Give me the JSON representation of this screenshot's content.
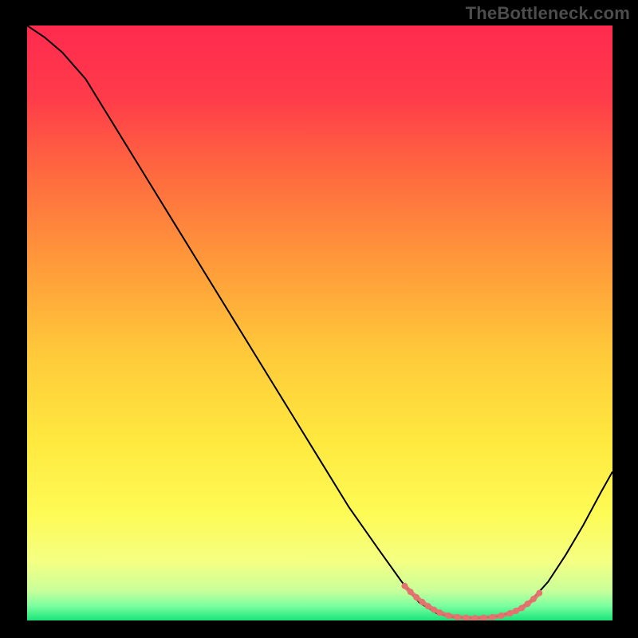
{
  "watermark": "TheBottleneck.com",
  "chart_data": {
    "type": "line",
    "title": "",
    "xlabel": "",
    "ylabel": "",
    "xlim": [
      0,
      100
    ],
    "ylim": [
      0,
      100
    ],
    "gradient_stops": [
      {
        "offset": 0.0,
        "color": "#ff2a4f"
      },
      {
        "offset": 0.12,
        "color": "#ff3b4a"
      },
      {
        "offset": 0.25,
        "color": "#ff6a3f"
      },
      {
        "offset": 0.4,
        "color": "#ff9a3a"
      },
      {
        "offset": 0.55,
        "color": "#ffc93a"
      },
      {
        "offset": 0.7,
        "color": "#ffe93f"
      },
      {
        "offset": 0.82,
        "color": "#fdfb55"
      },
      {
        "offset": 0.9,
        "color": "#f5ff82"
      },
      {
        "offset": 0.95,
        "color": "#c9ff9a"
      },
      {
        "offset": 0.975,
        "color": "#7dffa0"
      },
      {
        "offset": 1.0,
        "color": "#19e57a"
      }
    ],
    "series": [
      {
        "name": "bottleneck-curve",
        "stroke": "#000000",
        "stroke_width": 2,
        "points": [
          {
            "x": 0.0,
            "y": 100.0
          },
          {
            "x": 3.0,
            "y": 98.0
          },
          {
            "x": 6.0,
            "y": 95.5
          },
          {
            "x": 10.0,
            "y": 91.0
          },
          {
            "x": 15.0,
            "y": 83.0
          },
          {
            "x": 20.0,
            "y": 75.0
          },
          {
            "x": 25.0,
            "y": 67.0
          },
          {
            "x": 30.0,
            "y": 59.0
          },
          {
            "x": 35.0,
            "y": 51.0
          },
          {
            "x": 40.0,
            "y": 43.0
          },
          {
            "x": 45.0,
            "y": 35.0
          },
          {
            "x": 50.0,
            "y": 27.0
          },
          {
            "x": 55.0,
            "y": 19.0
          },
          {
            "x": 60.0,
            "y": 12.0
          },
          {
            "x": 64.0,
            "y": 6.5
          },
          {
            "x": 67.0,
            "y": 3.0
          },
          {
            "x": 70.0,
            "y": 1.2
          },
          {
            "x": 73.0,
            "y": 0.5
          },
          {
            "x": 77.0,
            "y": 0.4
          },
          {
            "x": 80.0,
            "y": 0.6
          },
          {
            "x": 83.0,
            "y": 1.4
          },
          {
            "x": 86.0,
            "y": 3.2
          },
          {
            "x": 89.0,
            "y": 6.5
          },
          {
            "x": 92.0,
            "y": 11.0
          },
          {
            "x": 95.0,
            "y": 16.0
          },
          {
            "x": 98.0,
            "y": 21.5
          },
          {
            "x": 100.0,
            "y": 25.0
          }
        ]
      },
      {
        "name": "optimal-range-markers",
        "stroke": "#e4736f",
        "stroke_width": 8,
        "linecap": "round",
        "points": [
          {
            "x": 64.5,
            "y": 5.8
          },
          {
            "x": 65.5,
            "y": 4.8
          },
          {
            "x": 66.5,
            "y": 3.9
          },
          {
            "x": 67.5,
            "y": 3.1
          },
          {
            "x": 68.5,
            "y": 2.4
          },
          {
            "x": 69.5,
            "y": 1.8
          },
          {
            "x": 70.5,
            "y": 1.3
          },
          {
            "x": 72.0,
            "y": 0.8
          },
          {
            "x": 73.5,
            "y": 0.55
          },
          {
            "x": 75.0,
            "y": 0.45
          },
          {
            "x": 76.5,
            "y": 0.4
          },
          {
            "x": 78.0,
            "y": 0.45
          },
          {
            "x": 79.5,
            "y": 0.55
          },
          {
            "x": 81.0,
            "y": 0.8
          },
          {
            "x": 82.5,
            "y": 1.2
          },
          {
            "x": 83.5,
            "y": 1.6
          },
          {
            "x": 84.5,
            "y": 2.1
          },
          {
            "x": 85.5,
            "y": 2.8
          },
          {
            "x": 86.5,
            "y": 3.6
          },
          {
            "x": 87.5,
            "y": 4.6
          }
        ]
      }
    ]
  }
}
